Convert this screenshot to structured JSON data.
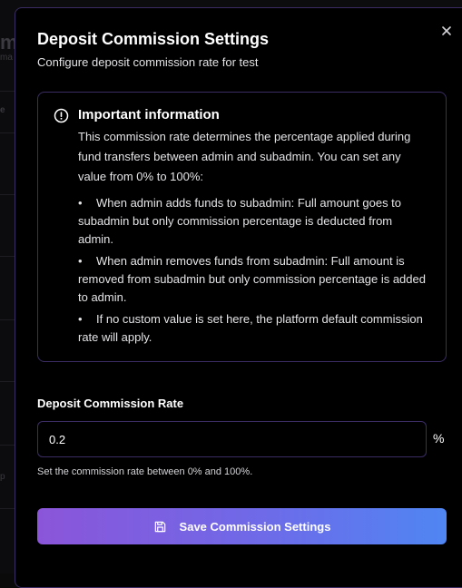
{
  "background": {
    "fragment_1": "m",
    "fragment_2": "ma",
    "fragment_3": "e",
    "fragment_4": "p"
  },
  "modal": {
    "title": "Deposit Commission Settings",
    "subtitle": "Configure deposit commission rate for test",
    "close_icon": "close-icon"
  },
  "info": {
    "icon": "info-circle-icon",
    "title": "Important information",
    "text": "This commission rate determines the percentage applied during fund transfers between admin and subadmin. You can set any value from 0% to 100%:",
    "bullet_glyph": "•",
    "bullets": [
      "When admin adds funds to subadmin: Full amount goes to subadmin but only commission percentage is deducted from admin.",
      "When admin removes funds from subadmin: Full amount is removed from subadmin but only commission percentage is added to admin.",
      "If no custom value is set here, the platform default commission rate will apply."
    ]
  },
  "rate": {
    "label": "Deposit Commission Rate",
    "value": "0.2",
    "unit": "%",
    "hint": "Set the commission rate between 0% and 100%."
  },
  "save_button": {
    "label": "Save Commission Settings",
    "icon": "save-icon"
  },
  "colors": {
    "accent_border": "#3b2d63",
    "button_gradient_start": "#8b55d9",
    "button_gradient_end": "#4f86f2",
    "background": "#000000"
  }
}
